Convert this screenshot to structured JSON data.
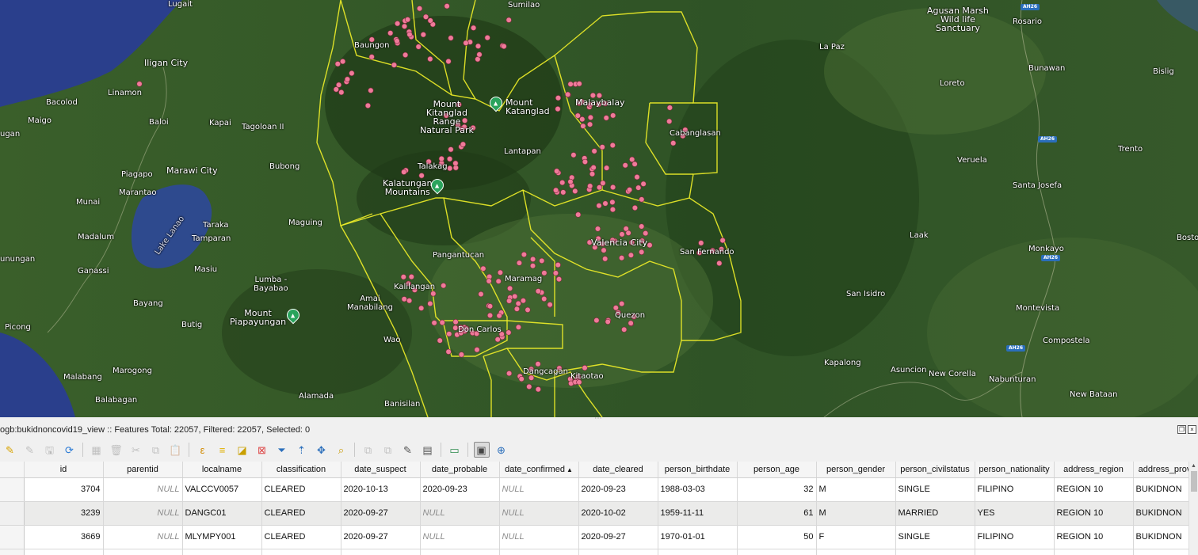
{
  "map": {
    "places": [
      {
        "id": "lugait",
        "name": "Lugait",
        "cls": ""
      },
      {
        "id": "iligan",
        "name": "Iligan City",
        "cls": "city"
      },
      {
        "id": "linamon",
        "name": "Linamon",
        "cls": ""
      },
      {
        "id": "bacolod",
        "name": "Bacolod",
        "cls": ""
      },
      {
        "id": "maigo",
        "name": "Maigo",
        "cls": ""
      },
      {
        "id": "baloi",
        "name": "Baloi",
        "cls": ""
      },
      {
        "id": "kapai",
        "name": "Kapai",
        "cls": ""
      },
      {
        "id": "tagoloan",
        "name": "Tagoloan II",
        "cls": ""
      },
      {
        "id": "ugan",
        "name": "ugan",
        "cls": ""
      },
      {
        "id": "piagapo",
        "name": "Piagapo",
        "cls": ""
      },
      {
        "id": "marawi",
        "name": "Marawi City",
        "cls": "city"
      },
      {
        "id": "bubong",
        "name": "Bubong",
        "cls": ""
      },
      {
        "id": "marantao",
        "name": "Marantao",
        "cls": ""
      },
      {
        "id": "munai",
        "name": "Munai",
        "cls": ""
      },
      {
        "id": "madalum",
        "name": "Madalum",
        "cls": ""
      },
      {
        "id": "lakelanao",
        "name": "Lake Lanao",
        "cls": ""
      },
      {
        "id": "taraka",
        "name": "Taraka",
        "cls": ""
      },
      {
        "id": "tamparan",
        "name": "Tamparan",
        "cls": ""
      },
      {
        "id": "maguing",
        "name": "Maguing",
        "cls": ""
      },
      {
        "id": "unungan",
        "name": "unungan",
        "cls": ""
      },
      {
        "id": "ganassi",
        "name": "Ganassi",
        "cls": ""
      },
      {
        "id": "masiu",
        "name": "Masiu",
        "cls": ""
      },
      {
        "id": "lumba",
        "name": "Lumba -\nBayabao",
        "cls": "center"
      },
      {
        "id": "amai",
        "name": "Amai\nManabilang",
        "cls": "center"
      },
      {
        "id": "bayang",
        "name": "Bayang",
        "cls": ""
      },
      {
        "id": "piapayungan",
        "name": "Mount\nPiapayungan",
        "cls": "center city"
      },
      {
        "id": "butig",
        "name": "Butig",
        "cls": ""
      },
      {
        "id": "picong",
        "name": "Picong",
        "cls": ""
      },
      {
        "id": "wao",
        "name": "Wao",
        "cls": ""
      },
      {
        "id": "marogong",
        "name": "Marogong",
        "cls": ""
      },
      {
        "id": "malabang",
        "name": "Malabang",
        "cls": ""
      },
      {
        "id": "alamada",
        "name": "Alamada",
        "cls": ""
      },
      {
        "id": "balabagan",
        "name": "Balabagan",
        "cls": ""
      },
      {
        "id": "banisilan",
        "name": "Banisilan",
        "cls": ""
      },
      {
        "id": "baungon",
        "name": "Baungon",
        "cls": ""
      },
      {
        "id": "sumilao",
        "name": "Sumilao",
        "cls": ""
      },
      {
        "id": "kitanglad",
        "name": "Mount\nKitanglad\nRange\nNatural Park",
        "cls": "center city"
      },
      {
        "id": "katanglad",
        "name": "Mount\nKatanglad",
        "cls": "city"
      },
      {
        "id": "malaybalay",
        "name": "Malaybalay",
        "cls": "city"
      },
      {
        "id": "lantapan",
        "name": "Lantapan",
        "cls": ""
      },
      {
        "id": "talakag",
        "name": "Talakag",
        "cls": ""
      },
      {
        "id": "cabanglasan",
        "name": "Cabanglasan",
        "cls": ""
      },
      {
        "id": "kalatungan",
        "name": "Kalatungan\nMountains",
        "cls": "center city"
      },
      {
        "id": "valencia",
        "name": "Valencia City",
        "cls": "city"
      },
      {
        "id": "pangantucan",
        "name": "Pangantucan",
        "cls": ""
      },
      {
        "id": "sanfernando",
        "name": "San Fernando",
        "cls": ""
      },
      {
        "id": "kalilangan",
        "name": "Kalilangan",
        "cls": ""
      },
      {
        "id": "maramag",
        "name": "Maramag",
        "cls": ""
      },
      {
        "id": "quezon",
        "name": "Quezon",
        "cls": ""
      },
      {
        "id": "doncarlos",
        "name": "Don Carlos",
        "cls": ""
      },
      {
        "id": "dangcagan",
        "name": "Dangcagan",
        "cls": ""
      },
      {
        "id": "kitaotao",
        "name": "Kitaotao",
        "cls": ""
      },
      {
        "id": "agusan",
        "name": "Agusan Marsh\nWild life\nSanctuary",
        "cls": "center city"
      },
      {
        "id": "rosario",
        "name": "Rosario",
        "cls": ""
      },
      {
        "id": "lapaz",
        "name": "La Paz",
        "cls": ""
      },
      {
        "id": "bunawan",
        "name": "Bunawan",
        "cls": ""
      },
      {
        "id": "bislig",
        "name": "Bislig",
        "cls": ""
      },
      {
        "id": "loreto",
        "name": "Loreto",
        "cls": ""
      },
      {
        "id": "veruela",
        "name": "Veruela",
        "cls": ""
      },
      {
        "id": "trento",
        "name": "Trento",
        "cls": ""
      },
      {
        "id": "santajosefa",
        "name": "Santa Josefa",
        "cls": ""
      },
      {
        "id": "laak",
        "name": "Laak",
        "cls": ""
      },
      {
        "id": "boston",
        "name": "Bosto",
        "cls": ""
      },
      {
        "id": "monkayo",
        "name": "Monkayo",
        "cls": ""
      },
      {
        "id": "sanisidro",
        "name": "San Isidro",
        "cls": ""
      },
      {
        "id": "montevista",
        "name": "Montevista",
        "cls": ""
      },
      {
        "id": "compostela",
        "name": "Compostela",
        "cls": ""
      },
      {
        "id": "kapalong",
        "name": "Kapalong",
        "cls": ""
      },
      {
        "id": "asuncion",
        "name": "Asuncion",
        "cls": ""
      },
      {
        "id": "newcorella",
        "name": "New Corella",
        "cls": ""
      },
      {
        "id": "nabunturan",
        "name": "Nabunturan",
        "cls": ""
      },
      {
        "id": "newbataan",
        "name": "New Bataan",
        "cls": ""
      }
    ],
    "shields": [
      "AH26",
      "AH26",
      "AH26",
      "AH26"
    ]
  },
  "panel": {
    "title": "ogb:bukidnoncovid19_view :: Features Total: 22057, Filtered: 22057, Selected: 0"
  },
  "toolbar": [
    {
      "name": "toggle-editing-icon",
      "glyph": "✎",
      "state": "on",
      "color": "#d9a400"
    },
    {
      "name": "multi-edit-icon",
      "glyph": "✎",
      "state": "dis",
      "color": "#666"
    },
    {
      "name": "save-edits-icon",
      "glyph": "🖫",
      "state": "dis",
      "color": "#555"
    },
    {
      "name": "reload-icon",
      "glyph": "⟳",
      "state": "on",
      "color": "#2a7ad5"
    },
    {
      "name": "sep",
      "glyph": "",
      "state": "sep",
      "color": ""
    },
    {
      "name": "add-feature-icon",
      "glyph": "▦",
      "state": "dis",
      "color": "#666"
    },
    {
      "name": "delete-feature-icon",
      "glyph": "🗑",
      "state": "dis",
      "color": "#666"
    },
    {
      "name": "cut-icon",
      "glyph": "✂",
      "state": "dis",
      "color": "#666"
    },
    {
      "name": "copy-icon",
      "glyph": "⧉",
      "state": "dis",
      "color": "#666"
    },
    {
      "name": "paste-icon",
      "glyph": "📋",
      "state": "dis",
      "color": "#666"
    },
    {
      "name": "sep",
      "glyph": "",
      "state": "sep",
      "color": ""
    },
    {
      "name": "select-expression-icon",
      "glyph": "ε",
      "state": "on",
      "color": "#d18a00"
    },
    {
      "name": "select-all-icon",
      "glyph": "≡",
      "state": "on",
      "color": "#e0b000"
    },
    {
      "name": "invert-selection-icon",
      "glyph": "◪",
      "state": "on",
      "color": "#c9a000"
    },
    {
      "name": "deselect-all-icon",
      "glyph": "⊠",
      "state": "on",
      "color": "#d44"
    },
    {
      "name": "filter-icon",
      "glyph": "⏷",
      "state": "on",
      "color": "#2a6ebb"
    },
    {
      "name": "move-selection-top-icon",
      "glyph": "⇡",
      "state": "on",
      "color": "#2a6ebb"
    },
    {
      "name": "pan-to-selection-icon",
      "glyph": "✥",
      "state": "on",
      "color": "#2a6ebb"
    },
    {
      "name": "zoom-to-selection-icon",
      "glyph": "⌕",
      "state": "on",
      "color": "#c99a00"
    },
    {
      "name": "sep",
      "glyph": "",
      "state": "sep",
      "color": ""
    },
    {
      "name": "copy-rows-icon",
      "glyph": "⧉",
      "state": "dis",
      "color": "#666"
    },
    {
      "name": "paste-rows-icon",
      "glyph": "⧉",
      "state": "dis",
      "color": "#666"
    },
    {
      "name": "field-calculator-icon",
      "glyph": "✎",
      "state": "on",
      "color": "#555"
    },
    {
      "name": "conditional-format-icon",
      "glyph": "▤",
      "state": "on",
      "color": "#555"
    },
    {
      "name": "sep",
      "glyph": "",
      "state": "sep",
      "color": ""
    },
    {
      "name": "dock-icon",
      "glyph": "▭",
      "state": "on",
      "color": "#2a8a4a"
    },
    {
      "name": "sep",
      "glyph": "",
      "state": "sep",
      "color": ""
    },
    {
      "name": "actions-icon",
      "glyph": "▣",
      "state": "active",
      "color": "#444"
    },
    {
      "name": "zoom-map-icon",
      "glyph": "⊕",
      "state": "on",
      "color": "#2a6ebb"
    }
  ],
  "table": {
    "columns": [
      {
        "key": "id",
        "label": "id"
      },
      {
        "key": "parentid",
        "label": "parentid"
      },
      {
        "key": "localname",
        "label": "localname"
      },
      {
        "key": "classification",
        "label": "classification"
      },
      {
        "key": "date_suspect",
        "label": "date_suspect"
      },
      {
        "key": "date_probable",
        "label": "date_probable"
      },
      {
        "key": "date_confirmed",
        "label": "date_confirmed"
      },
      {
        "key": "date_cleared",
        "label": "date_cleared"
      },
      {
        "key": "person_birthdate",
        "label": "person_birthdate"
      },
      {
        "key": "person_age",
        "label": "person_age"
      },
      {
        "key": "person_gender",
        "label": "person_gender"
      },
      {
        "key": "person_civilstatus",
        "label": "person_civilstatus"
      },
      {
        "key": "person_nationality",
        "label": "person_nationality"
      },
      {
        "key": "address_region",
        "label": "address_region"
      },
      {
        "key": "address_prov",
        "label": "address_prov"
      }
    ],
    "sorted_column": "date_confirmed",
    "sort_glyph": "▲",
    "rows": [
      [
        "3704",
        "NULL",
        "VALCCV0057",
        "CLEARED",
        "2020-10-13",
        "2020-09-23",
        "NULL",
        "2020-09-23",
        "1988-03-03",
        "32",
        "M",
        "SINGLE",
        "FILIPINO",
        "REGION 10",
        "BUKIDNON"
      ],
      [
        "3239",
        "NULL",
        "DANGC01",
        "CLEARED",
        "2020-09-27",
        "NULL",
        "NULL",
        "2020-10-02",
        "1959-11-11",
        "61",
        "M",
        "MARRIED",
        "YES",
        "REGION 10",
        "BUKIDNON"
      ],
      [
        "3669",
        "NULL",
        "MLYMPY001",
        "CLEARED",
        "2020-09-27",
        "NULL",
        "NULL",
        "2020-09-27",
        "1970-01-01",
        "50",
        "F",
        "SINGLE",
        "FILIPINO",
        "REGION 10",
        "BUKIDNON"
      ]
    ]
  },
  "colors": {
    "boundary": "#f0ee28",
    "case_point": "#f07a9a",
    "lake": "#2e4a8e",
    "sea": "#2a3f8c",
    "mountain_pin": "#2aa35c"
  }
}
